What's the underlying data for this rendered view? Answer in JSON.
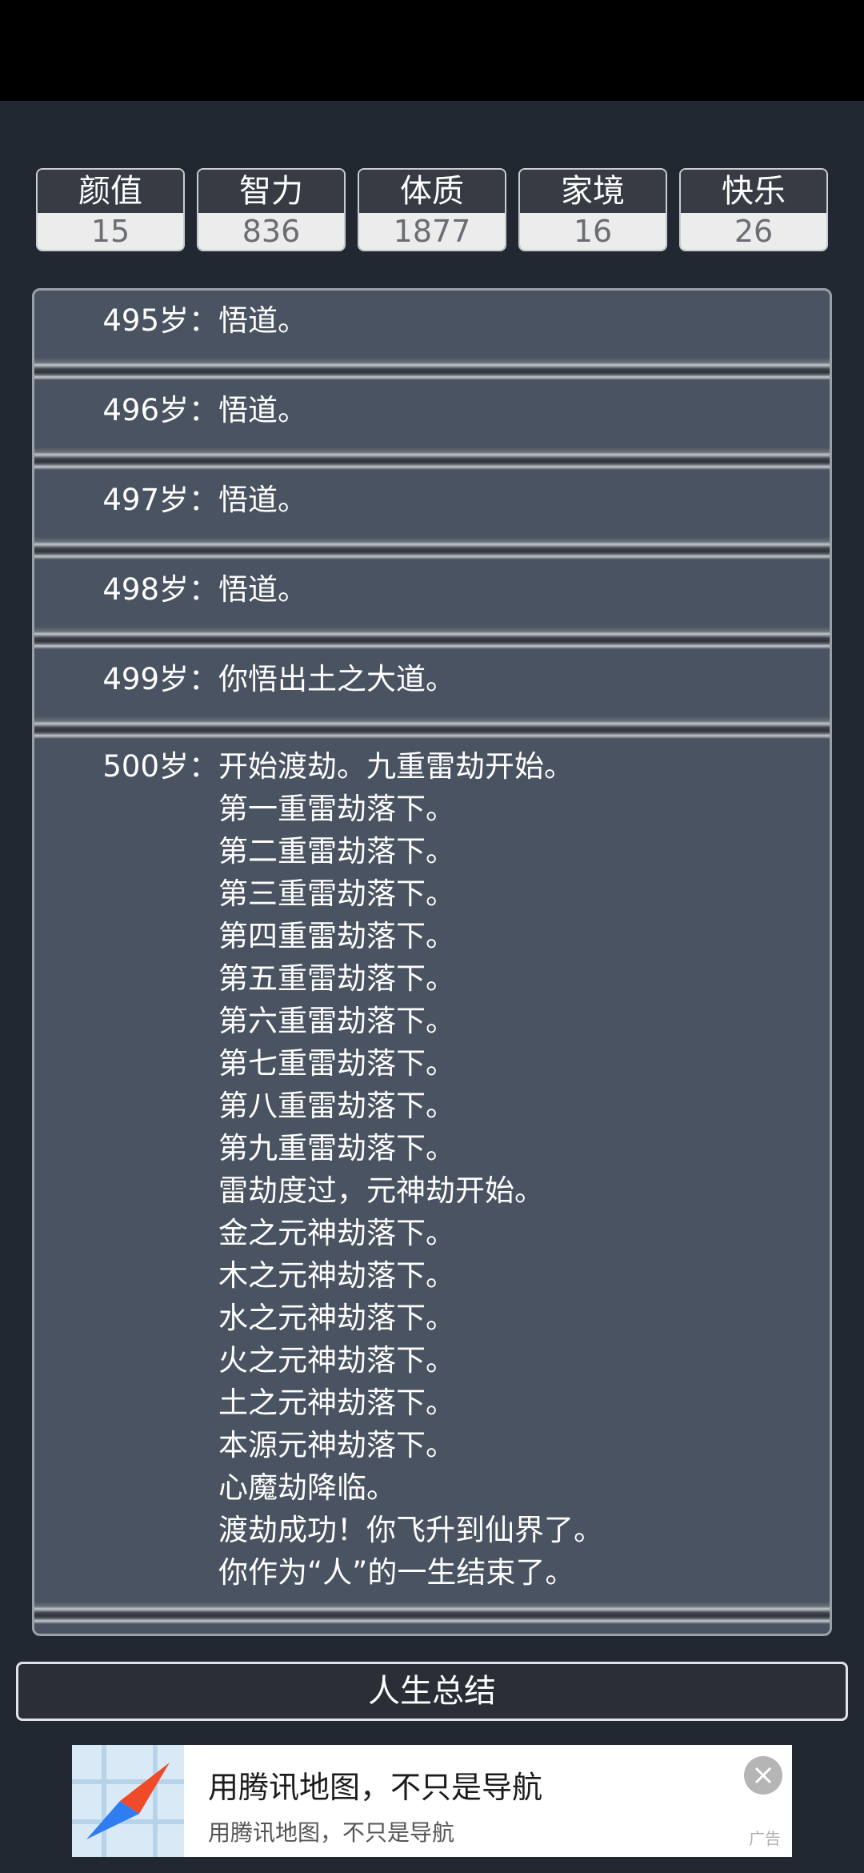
{
  "stats": [
    {
      "label": "颜值",
      "value": "15"
    },
    {
      "label": "智力",
      "value": "836"
    },
    {
      "label": "体质",
      "value": "1877"
    },
    {
      "label": "家境",
      "value": "16"
    },
    {
      "label": "快乐",
      "value": "26"
    }
  ],
  "log": [
    {
      "age": "495岁",
      "lines": [
        "悟道。"
      ]
    },
    {
      "age": "496岁",
      "lines": [
        "悟道。"
      ]
    },
    {
      "age": "497岁",
      "lines": [
        "悟道。"
      ]
    },
    {
      "age": "498岁",
      "lines": [
        "悟道。"
      ]
    },
    {
      "age": "499岁",
      "lines": [
        "你悟出土之大道。"
      ]
    },
    {
      "age": "500岁",
      "lines": [
        "开始渡劫。九重雷劫开始。",
        "第一重雷劫落下。",
        "第二重雷劫落下。",
        "第三重雷劫落下。",
        "第四重雷劫落下。",
        "第五重雷劫落下。",
        "第六重雷劫落下。",
        "第七重雷劫落下。",
        "第八重雷劫落下。",
        "第九重雷劫落下。",
        "雷劫度过，元神劫开始。",
        "金之元神劫落下。",
        "木之元神劫落下。",
        "水之元神劫落下。",
        "火之元神劫落下。",
        "土之元神劫落下。",
        "本源元神劫落下。",
        "心魔劫降临。",
        "渡劫成功！你飞升到仙界了。",
        "你作为“人”的一生结束了。"
      ]
    }
  ],
  "colon": "：",
  "summary_button": "人生总结",
  "ad": {
    "title": "用腾讯地图，不只是导航",
    "subtitle": "用腾讯地图，不只是导航",
    "tag": "广告"
  }
}
